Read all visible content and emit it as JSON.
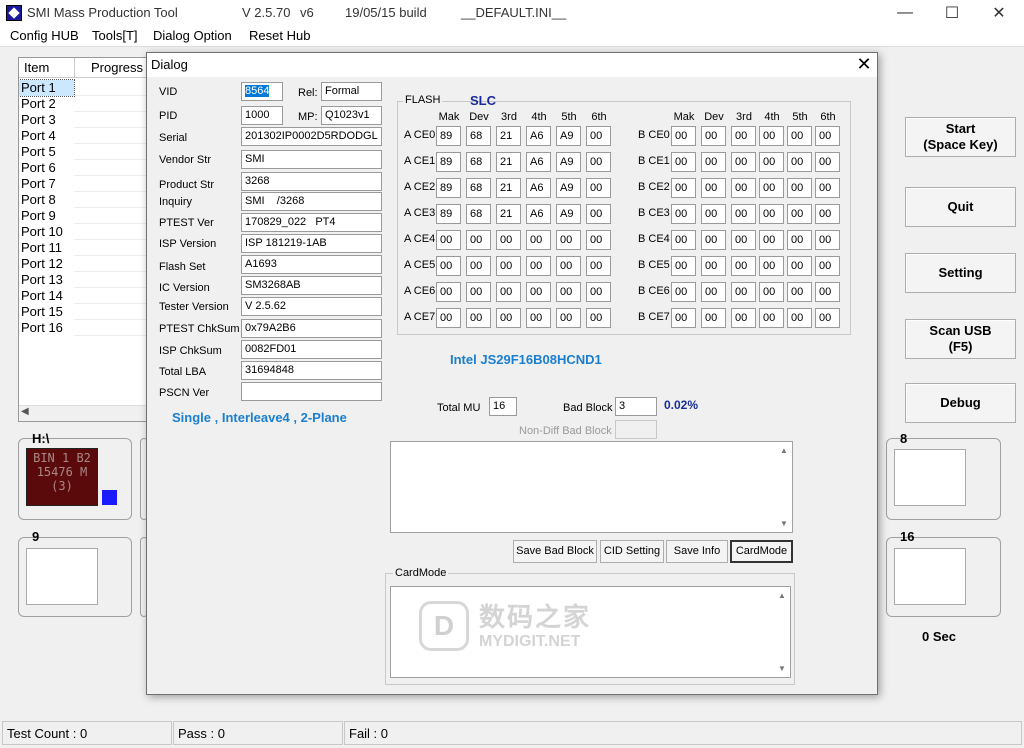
{
  "window": {
    "app_name": "SMI Mass Production Tool",
    "version": "V 2.5.70",
    "build_variant": "v6",
    "build_date": "19/05/15 build",
    "ini_file": "__DEFAULT.INI__",
    "minimize": "—",
    "maximize": "☐",
    "close": "✕"
  },
  "menu": [
    "Config HUB",
    "Tools[T]",
    "Dialog Option",
    "Reset Hub"
  ],
  "port_list": {
    "columns": [
      "Item",
      "Progress"
    ],
    "ports": [
      "Port 1",
      "Port 2",
      "Port 3",
      "Port 4",
      "Port 5",
      "Port 6",
      "Port 7",
      "Port 8",
      "Port 9",
      "Port 10",
      "Port 11",
      "Port 12",
      "Port 13",
      "Port 14",
      "Port 15",
      "Port 16"
    ],
    "selected_index": 0
  },
  "drives": {
    "h_label": "H:\\",
    "h_display": "BIN 1 B2\n15476 M\n(3)",
    "panel_9": "9",
    "panel_8": "8",
    "panel_16": "16"
  },
  "buttons": {
    "start_line1": "Start",
    "start_line2": "(Space Key)",
    "quit": "Quit",
    "setting": "Setting",
    "scan_usb_line1": "Scan USB",
    "scan_usb_line2": "(F5)",
    "debug": "Debug"
  },
  "timer": "0 Sec",
  "status_bar": {
    "test_count": "Test Count : 0",
    "pass": "Pass : 0",
    "fail": "Fail : 0"
  },
  "dialog": {
    "title": "Dialog",
    "close": "✕",
    "fields": {
      "vid_label": "VID",
      "vid": "8564",
      "rel_label": "Rel:",
      "rel": "Formal",
      "pid_label": "PID",
      "pid": "1000",
      "mp_label": "MP:",
      "mp": "Q1023v1",
      "serial_label": "Serial",
      "serial": "201302IP0002D5RDODGL",
      "vendor_label": "Vendor Str",
      "vendor": "SMI",
      "product_label": "Product Str",
      "product": "3268",
      "inquiry_label": "Inquiry",
      "inquiry": "SMI    /3268",
      "ptest_ver_label": "PTEST Ver",
      "ptest_ver": "170829_022   PT4",
      "isp_ver_label": "ISP Version",
      "isp_ver": "ISP 181219-1AB",
      "flash_set_label": "Flash Set",
      "flash_set": "A1693",
      "ic_ver_label": "IC Version",
      "ic_ver": "SM3268AB",
      "tester_ver_label": "Tester Version",
      "tester_ver": "V 2.5.62",
      "ptest_chk_label": "PTEST ChkSum",
      "ptest_chk": "0x79A2B6",
      "isp_chk_label": "ISP ChkSum",
      "isp_chk": "0082FD01",
      "total_lba_label": "Total LBA",
      "total_lba": "31694848",
      "pscn_label": "PSCN Ver",
      "pscn": ""
    },
    "interleave_info": "Single , Interleave4 , 2-Plane",
    "flash": {
      "legend": "FLASH",
      "cell_type": "SLC",
      "columns": [
        "Mak",
        "Dev",
        "3rd",
        "4th",
        "5th",
        "6th"
      ],
      "a_labels": [
        "A CE0",
        "A CE1",
        "A CE2",
        "A CE3",
        "A CE4",
        "A CE5",
        "A CE6",
        "A CE7"
      ],
      "b_labels": [
        "B CE0",
        "B CE1",
        "B CE2",
        "B CE3",
        "B CE4",
        "B CE5",
        "B CE6",
        "B CE7"
      ],
      "a_rows": [
        [
          "89",
          "68",
          "21",
          "A6",
          "A9",
          "00"
        ],
        [
          "89",
          "68",
          "21",
          "A6",
          "A9",
          "00"
        ],
        [
          "89",
          "68",
          "21",
          "A6",
          "A9",
          "00"
        ],
        [
          "89",
          "68",
          "21",
          "A6",
          "A9",
          "00"
        ],
        [
          "00",
          "00",
          "00",
          "00",
          "00",
          "00"
        ],
        [
          "00",
          "00",
          "00",
          "00",
          "00",
          "00"
        ],
        [
          "00",
          "00",
          "00",
          "00",
          "00",
          "00"
        ],
        [
          "00",
          "00",
          "00",
          "00",
          "00",
          "00"
        ]
      ],
      "b_rows": [
        [
          "00",
          "00",
          "00",
          "00",
          "00",
          "00"
        ],
        [
          "00",
          "00",
          "00",
          "00",
          "00",
          "00"
        ],
        [
          "00",
          "00",
          "00",
          "00",
          "00",
          "00"
        ],
        [
          "00",
          "00",
          "00",
          "00",
          "00",
          "00"
        ],
        [
          "00",
          "00",
          "00",
          "00",
          "00",
          "00"
        ],
        [
          "00",
          "00",
          "00",
          "00",
          "00",
          "00"
        ],
        [
          "00",
          "00",
          "00",
          "00",
          "00",
          "00"
        ],
        [
          "00",
          "00",
          "00",
          "00",
          "00",
          "00"
        ]
      ],
      "model": "Intel JS29F16B08HCND1"
    },
    "total_mu_label": "Total MU",
    "total_mu": "16",
    "bad_block_label": "Bad Block",
    "bad_block": "3",
    "bad_block_pct": "0.02%",
    "nondiff_label": "Non-Diff Bad Block",
    "nondiff": "",
    "action_buttons": [
      "Save Bad Block",
      "CID Setting",
      "Save Info",
      "CardMode"
    ],
    "cardmode_legend": "CardMode"
  },
  "watermark": {
    "cn": "数码之家",
    "en": "MYDIGIT.NET"
  }
}
